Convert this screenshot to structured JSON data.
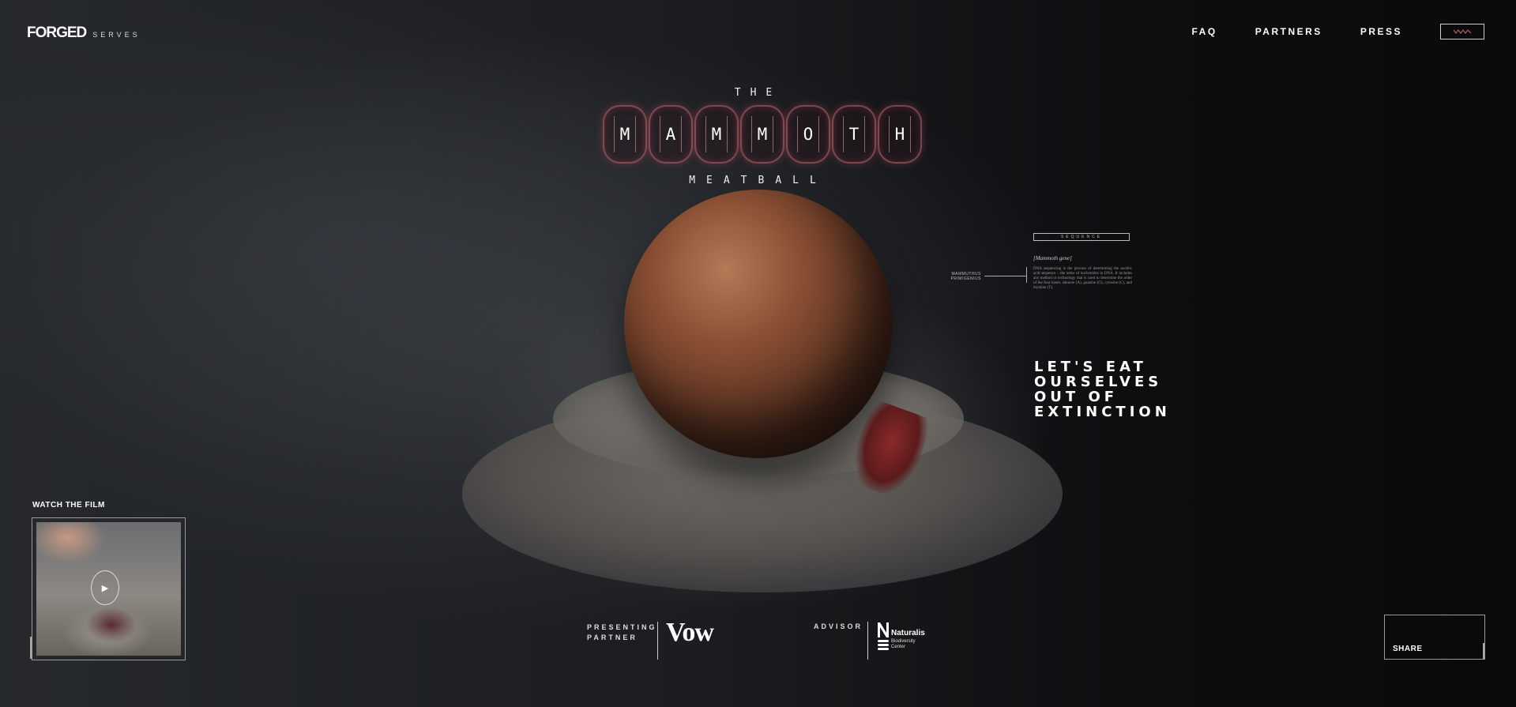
{
  "brand": {
    "name": "FORGED",
    "tagline": "SERVES"
  },
  "nav": {
    "items": [
      "FAQ",
      "PARTNERS",
      "PRESS"
    ]
  },
  "title": {
    "prefix": "THE",
    "letters": [
      "M",
      "A",
      "M",
      "M",
      "O",
      "T",
      "H"
    ],
    "suffix": "MEATBALL"
  },
  "annotation": {
    "sequence_label": "SEQUENCE",
    "gene_label": "MAMMUTHUS PRIMIGENIUS",
    "gene_title": "[Mammoth gene]",
    "gene_text": "DNA sequencing is the process of determining the nucleic acid sequence – the order of nucleotides in DNA. It includes any method or technology that is used to determine the order of the four bases: adenine (A), guanine (G), cytosine (C), and thymine (T)."
  },
  "slogan": [
    "LET'S EAT",
    "OURSELVES",
    "OUT OF",
    "EXTINCTION"
  ],
  "film": {
    "label": "WATCH THE FILM"
  },
  "partners": {
    "presenting_label_1": "PRESENTING",
    "presenting_label_2": "PARTNER",
    "presenting_name": "Vow",
    "advisor_label": "ADVISOR",
    "advisor_name": "Naturalis",
    "advisor_sub_1": "Biodiversity",
    "advisor_sub_2": "Center"
  },
  "share": {
    "label": "SHARE"
  },
  "colors": {
    "accent_glow": "#c86e78",
    "background": "#0d0e10"
  }
}
